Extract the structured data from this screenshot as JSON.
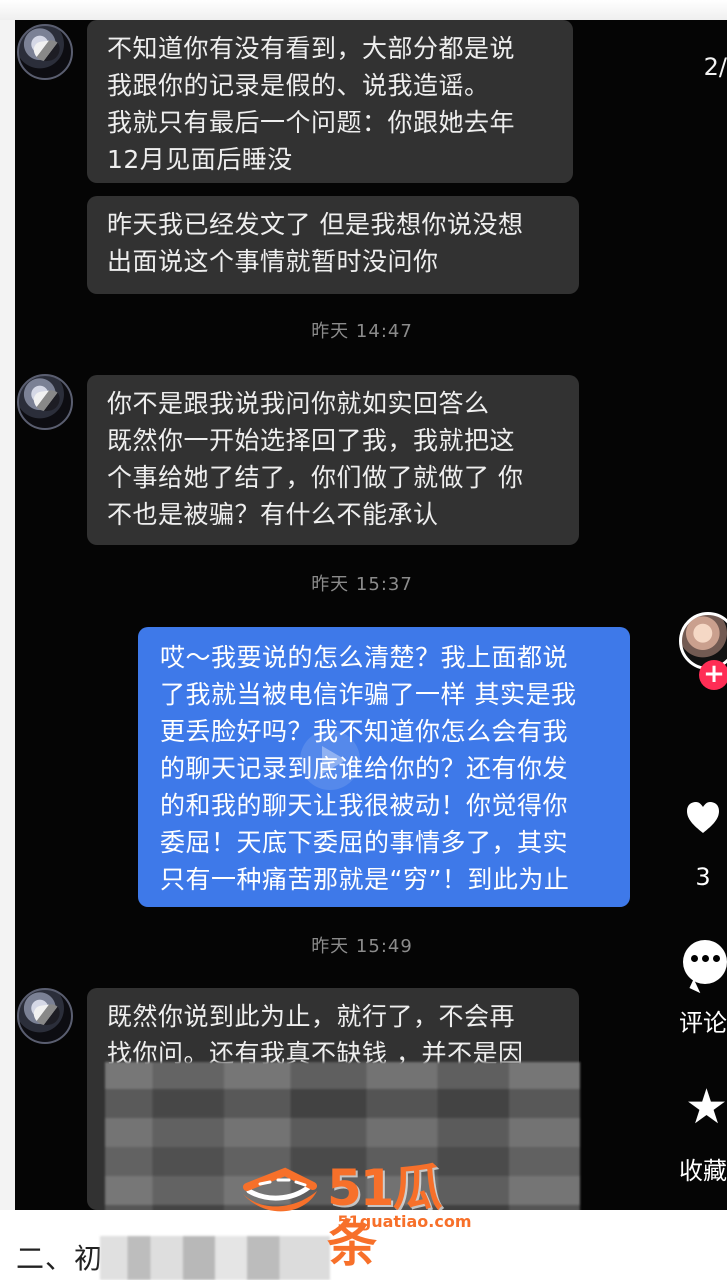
{
  "chat": {
    "messages": [
      {
        "type": "incoming",
        "text": "不知道你有没有看到，大部分都是说\n我跟你的记录是假的、说我造谣。\n我就只有最后一个问题：你跟她去年\n12月见面后睡没"
      },
      {
        "type": "incoming",
        "text": "昨天我已经发文了 但是我想你说没想\n出面说这个事情就暂时没问你"
      },
      {
        "type": "timestamp",
        "text": "昨天 14:47"
      },
      {
        "type": "incoming",
        "text": "你不是跟我说我问你就如实回答么\n既然你一开始选择回了我，我就把这\n个事给她了结了，你们做了就做了 你\n不也是被骗？有什么不能承认"
      },
      {
        "type": "timestamp",
        "text": "昨天 15:37"
      },
      {
        "type": "outgoing",
        "text": "哎～我要说的怎么清楚？我上面都说\n了我就当被电信诈骗了一样 其实是我\n更丢脸好吗？我不知道你怎么会有我\n的聊天记录到底谁给你的？还有你发\n的和我的聊天让我很被动！你觉得你\n委屈！天底下委屈的事情多了，其实\n只有一种痛苦那就是“穷”！到此为止"
      },
      {
        "type": "timestamp",
        "text": "昨天 15:49"
      },
      {
        "type": "incoming",
        "text": "既然你说到此为止，就行了，不会再\n找你问。还有我真不缺钱 ，并不是因"
      }
    ]
  },
  "side": {
    "page_indicator": "2/",
    "like_count": "3",
    "comment_label": "评论",
    "favorite_label": "收藏",
    "follow_icon": "plus-icon",
    "heart_icon": "heart-icon",
    "comment_icon": "comment-bubble-icon",
    "star_icon": "star-icon"
  },
  "watermark": {
    "brand": "51瓜条",
    "url": "51guatiao.com",
    "logo_icon": "watermelon-logo-icon"
  },
  "article": {
    "section_text": "二、初"
  },
  "colors": {
    "background": "#050505",
    "incoming_bubble": "#323232",
    "outgoing_bubble": "#3e79e9",
    "timestamp": "#8b8b8b",
    "watermark": "#f7702a",
    "follow_badge": "#ff2d55"
  }
}
